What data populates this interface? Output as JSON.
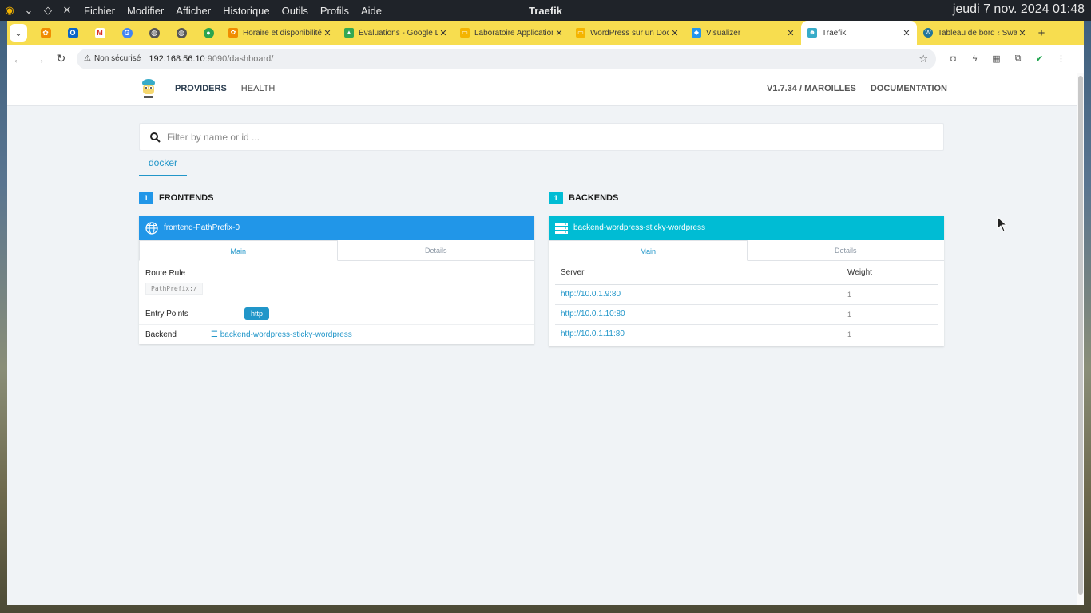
{
  "system_bar": {
    "window_title": "Traefik",
    "clock": "jeudi 7 nov. 2024 01:48",
    "menu": [
      "Fichier",
      "Modifier",
      "Afficher",
      "Historique",
      "Outils",
      "Profils",
      "Aide"
    ]
  },
  "tabs": [
    {
      "label": "Horaire et disponibilité",
      "fav_color": "#f08c00",
      "fav_char": "✿"
    },
    {
      "label": "Évaluations - Google Drive",
      "fav_color": "#34a853",
      "fav_char": "▲"
    },
    {
      "label": "Laboratoire Applications",
      "fav_color": "#f4b400",
      "fav_char": "▭"
    },
    {
      "label": "WordPress sur un Docker",
      "fav_color": "#f4b400",
      "fav_char": "▭"
    },
    {
      "label": "Visualizer",
      "fav_color": "#2496ed",
      "fav_char": "◆"
    },
    {
      "label": "Traefik",
      "fav_color": "#37abc8",
      "fav_char": "☻"
    },
    {
      "label": "Tableau de bord ‹ Swarm",
      "fav_color": "#21759b",
      "fav_char": "W"
    }
  ],
  "address_bar": {
    "security_label": "Non sécurisé",
    "host": "192.168.56.10",
    "path": ":9090/dashboard/"
  },
  "navbar": {
    "providers": "PROVIDERS",
    "health": "HEALTH",
    "version": "V1.7.34 / MAROILLES",
    "documentation": "DOCUMENTATION"
  },
  "filter": {
    "placeholder": "Filter by name or id ..."
  },
  "provider_tabs": [
    "docker"
  ],
  "frontends": {
    "count": "1",
    "title": "FRONTENDS",
    "name": "frontend-PathPrefix-0",
    "tab_main": "Main",
    "tab_details": "Details",
    "route_rule_label": "Route Rule",
    "route_rule_value": "PathPrefix:/",
    "entry_points_label": "Entry Points",
    "entry_point": "http",
    "backend_label": "Backend",
    "backend_value": "backend-wordpress-sticky-wordpress",
    "color": "#2196e8"
  },
  "backends": {
    "count": "1",
    "title": "BACKENDS",
    "name": "backend-wordpress-sticky-wordpress",
    "tab_main": "Main",
    "tab_details": "Details",
    "col_server": "Server",
    "col_weight": "Weight",
    "servers": [
      {
        "url": "http://10.0.1.9:80",
        "weight": "1"
      },
      {
        "url": "http://10.0.1.10:80",
        "weight": "1"
      },
      {
        "url": "http://10.0.1.11:80",
        "weight": "1"
      }
    ],
    "color": "#00bcd4"
  }
}
